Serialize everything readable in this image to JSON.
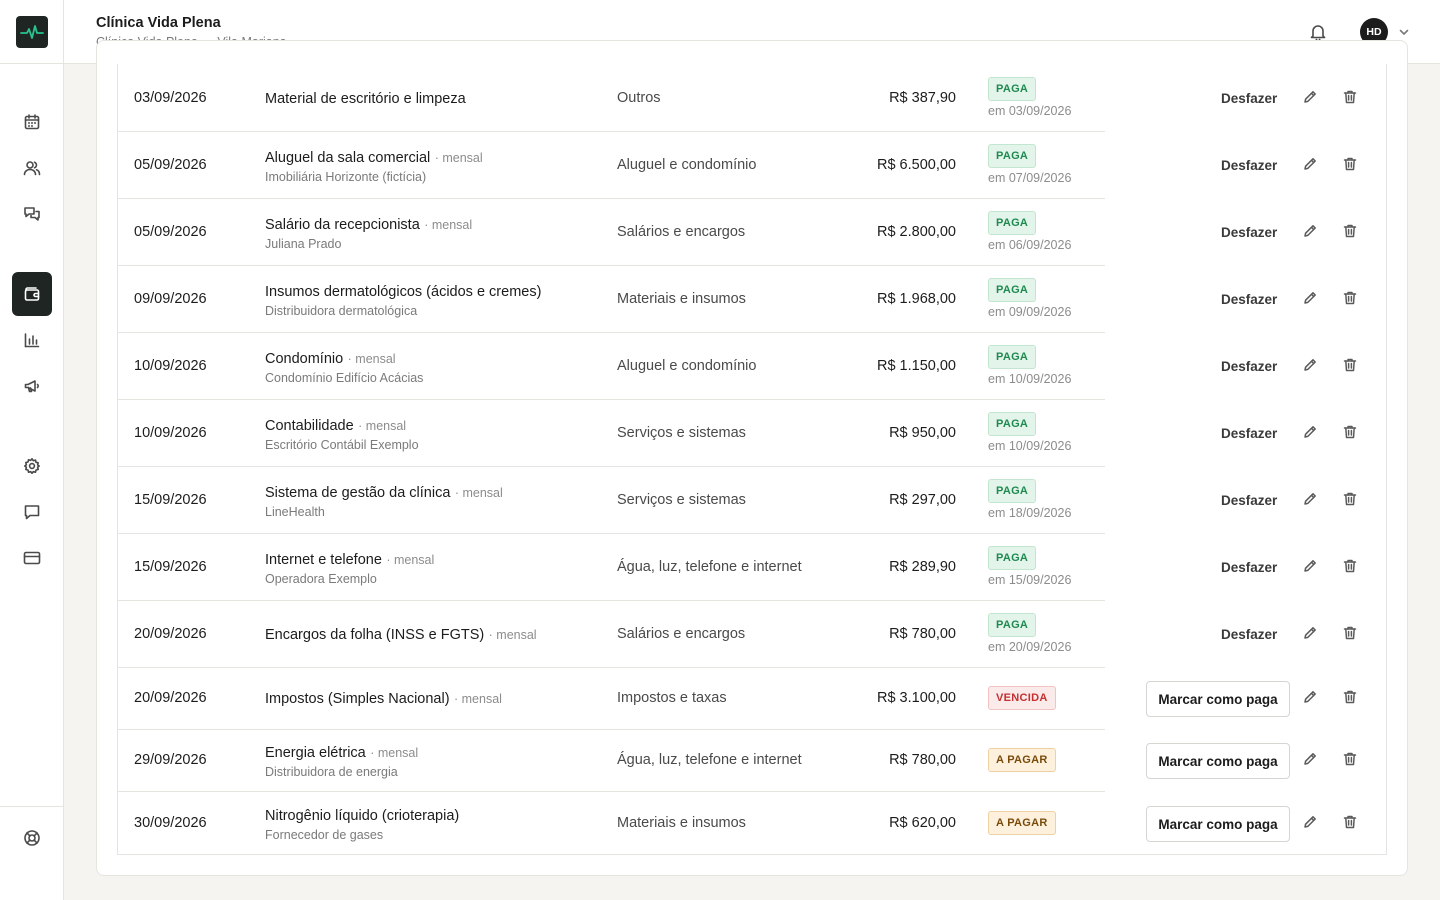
{
  "header": {
    "clinic_name": "Clínica Vida Plena",
    "clinic_sub": "Clínica Vida Plena — Vila Mariana",
    "avatar_initials": "HD"
  },
  "sidebar": {
    "items": [
      {
        "icon": "calendar-icon"
      },
      {
        "icon": "users-icon"
      },
      {
        "icon": "chat-bubbles-icon"
      },
      {
        "icon": "wallet-icon",
        "active": true
      },
      {
        "icon": "bar-chart-icon"
      },
      {
        "icon": "megaphone-icon"
      },
      {
        "icon": "gear-icon"
      },
      {
        "icon": "message-icon"
      },
      {
        "icon": "credit-card-icon"
      },
      {
        "icon": "lifebuoy-icon"
      }
    ]
  },
  "labels": {
    "desfazer": "Desfazer",
    "marcar_como_paga": "Marcar como paga"
  },
  "rows": [
    {
      "date": "03/09/2026",
      "title": "Material de escritório e limpeza",
      "recurring": "",
      "sub": "",
      "category": "Outros",
      "amount": "R$ 387,90",
      "status": "PAGA",
      "paid_on": "em 03/09/2026"
    },
    {
      "date": "05/09/2026",
      "title": "Aluguel da sala comercial",
      "recurring": "· mensal",
      "sub": "Imobiliária Horizonte (fictícia)",
      "category": "Aluguel e condomínio",
      "amount": "R$ 6.500,00",
      "status": "PAGA",
      "paid_on": "em 07/09/2026"
    },
    {
      "date": "05/09/2026",
      "title": "Salário da recepcionista",
      "recurring": "· mensal",
      "sub": "Juliana Prado",
      "category": "Salários e encargos",
      "amount": "R$ 2.800,00",
      "status": "PAGA",
      "paid_on": "em 06/09/2026"
    },
    {
      "date": "09/09/2026",
      "title": "Insumos dermatológicos (ácidos e cremes)",
      "recurring": "",
      "sub": "Distribuidora dermatológica",
      "category": "Materiais e insumos",
      "amount": "R$ 1.968,00",
      "status": "PAGA",
      "paid_on": "em 09/09/2026"
    },
    {
      "date": "10/09/2026",
      "title": "Condomínio",
      "recurring": "· mensal",
      "sub": "Condomínio Edifício Acácias",
      "category": "Aluguel e condomínio",
      "amount": "R$ 1.150,00",
      "status": "PAGA",
      "paid_on": "em 10/09/2026"
    },
    {
      "date": "10/09/2026",
      "title": "Contabilidade",
      "recurring": "· mensal",
      "sub": "Escritório Contábil Exemplo",
      "category": "Serviços e sistemas",
      "amount": "R$ 950,00",
      "status": "PAGA",
      "paid_on": "em 10/09/2026"
    },
    {
      "date": "15/09/2026",
      "title": "Sistema de gestão da clínica",
      "recurring": "· mensal",
      "sub": "LineHealth",
      "category": "Serviços e sistemas",
      "amount": "R$ 297,00",
      "status": "PAGA",
      "paid_on": "em 18/09/2026"
    },
    {
      "date": "15/09/2026",
      "title": "Internet e telefone",
      "recurring": "· mensal",
      "sub": "Operadora Exemplo",
      "category": "Água, luz, telefone e internet",
      "amount": "R$ 289,90",
      "status": "PAGA",
      "paid_on": "em 15/09/2026"
    },
    {
      "date": "20/09/2026",
      "title": "Encargos da folha (INSS e FGTS)",
      "recurring": "· mensal",
      "sub": "",
      "category": "Salários e encargos",
      "amount": "R$ 780,00",
      "status": "PAGA",
      "paid_on": "em 20/09/2026"
    },
    {
      "date": "20/09/2026",
      "title": "Impostos (Simples Nacional)",
      "recurring": "· mensal",
      "sub": "",
      "category": "Impostos e taxas",
      "amount": "R$ 3.100,00",
      "status": "VENCIDA",
      "paid_on": ""
    },
    {
      "date": "29/09/2026",
      "title": "Energia elétrica",
      "recurring": "· mensal",
      "sub": "Distribuidora de energia",
      "category": "Água, luz, telefone e internet",
      "amount": "R$ 780,00",
      "status": "A PAGAR",
      "paid_on": ""
    },
    {
      "date": "30/09/2026",
      "title": "Nitrogênio líquido (crioterapia)",
      "recurring": "",
      "sub": "Fornecedor de gases",
      "category": "Materiais e insumos",
      "amount": "R$ 620,00",
      "status": "A PAGAR",
      "paid_on": ""
    }
  ]
}
